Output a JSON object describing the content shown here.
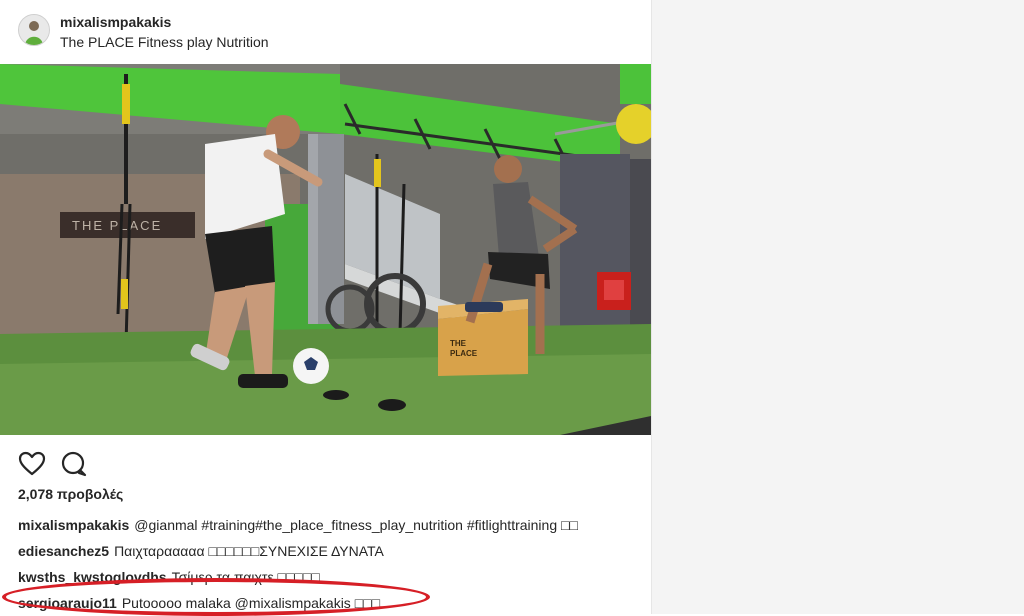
{
  "post": {
    "username": "mixalismpakakis",
    "location": "The PLACE Fitness play Nutrition",
    "views": "2,078 προβολές",
    "media": {
      "wall_sign": "THE PLACE",
      "box_label_1": "THE",
      "box_label_2": "PLACE"
    }
  },
  "actions": {
    "like_icon": "heart-icon",
    "comment_icon": "comment-icon"
  },
  "comments": [
    {
      "user": "mixalismpakakis",
      "text": "@gianmal #training#the_place_fitness_play_nutrition #fitlighttraining □□"
    },
    {
      "user": "ediesanchez5",
      "text": "Παιχταρααααα □□□□□□ΣΥΝΕΧΙΣΕ ΔΥΝΑΤΑ"
    },
    {
      "user": "kwsths_kwstoglovdhs",
      "text": "Τσίμερ τα παιχτε □□□□□"
    },
    {
      "user": "sergioaraujo11",
      "text": "Putooooo malaka @mixalismpakakis □□□"
    }
  ],
  "colors": {
    "highlight": "#d61f26",
    "accent_green": "#4cc23a"
  }
}
